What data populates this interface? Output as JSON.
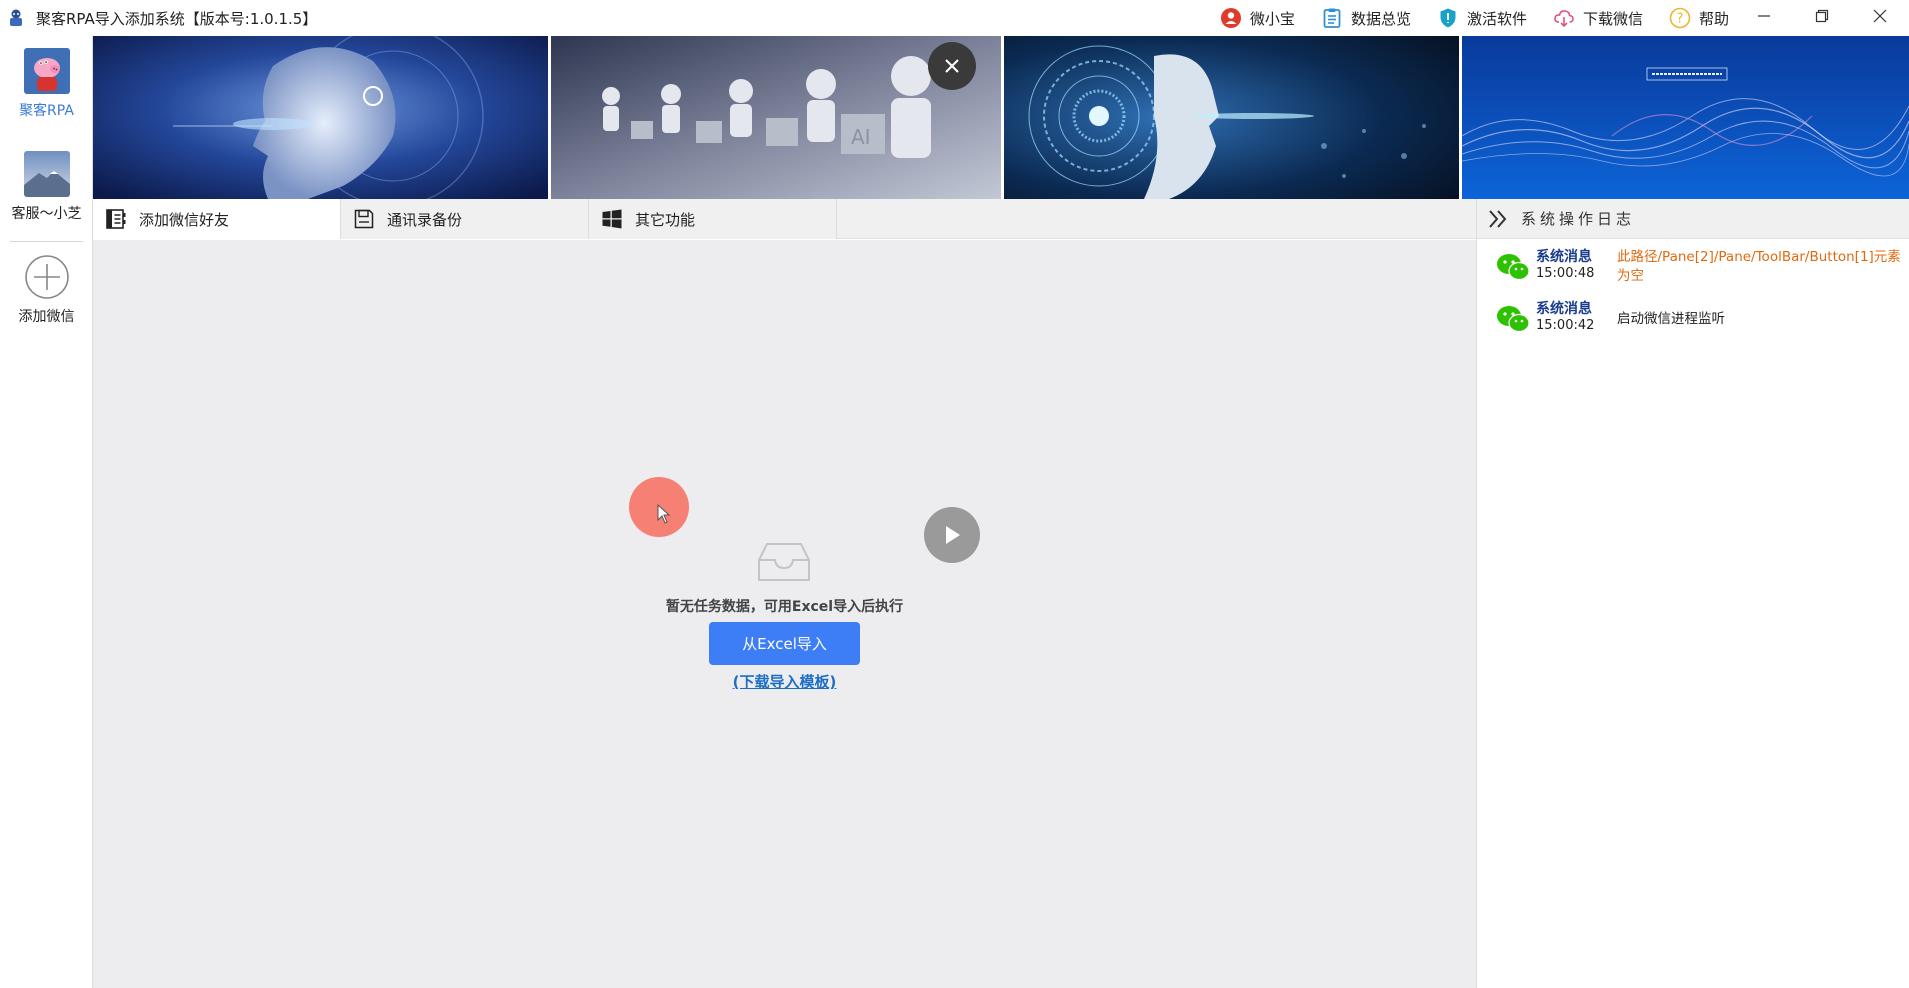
{
  "window": {
    "title": "聚客RPA导入添加系统【版本号:1.0.1.5】"
  },
  "top_menu": [
    {
      "label": "微小宝",
      "icon": "user-circle-icon",
      "color": "#e03a2a"
    },
    {
      "label": "数据总览",
      "icon": "clipboard-icon",
      "color": "#2f8fd8"
    },
    {
      "label": "激活软件",
      "icon": "shield-icon",
      "color": "#1aa3c8"
    },
    {
      "label": "下载微信",
      "icon": "cloud-download-icon",
      "color": "#e0567a"
    },
    {
      "label": "帮助",
      "icon": "help-icon",
      "color": "#f0b428"
    }
  ],
  "sidebar": {
    "accounts": [
      {
        "name": "聚客RPA",
        "active": true
      },
      {
        "name": "客服～小芝",
        "active": false
      }
    ],
    "add_label": "添加微信"
  },
  "tabs": [
    {
      "label": "添加微信好友",
      "active": true
    },
    {
      "label": "通讯录备份",
      "active": false
    },
    {
      "label": "其它功能",
      "active": false
    }
  ],
  "main": {
    "empty_text": "暂无任务数据，可用Excel导入后执行",
    "import_button": "从Excel导入",
    "template_link": "(下载导入模板)"
  },
  "log": {
    "title": "系统操作日志",
    "entries": [
      {
        "source": "系统消息",
        "time": "15:00:48",
        "message": "此路径/Pane[2]/Pane/ToolBar/Button[1]元素为空",
        "level": "warn"
      },
      {
        "source": "系统消息",
        "time": "15:00:42",
        "message": "启动微信进程监听",
        "level": "info"
      }
    ]
  },
  "colors": {
    "accent": "#3d7df5",
    "link": "#1e6fc4",
    "warning": "#e06a10",
    "content_bg": "#ededf0"
  }
}
